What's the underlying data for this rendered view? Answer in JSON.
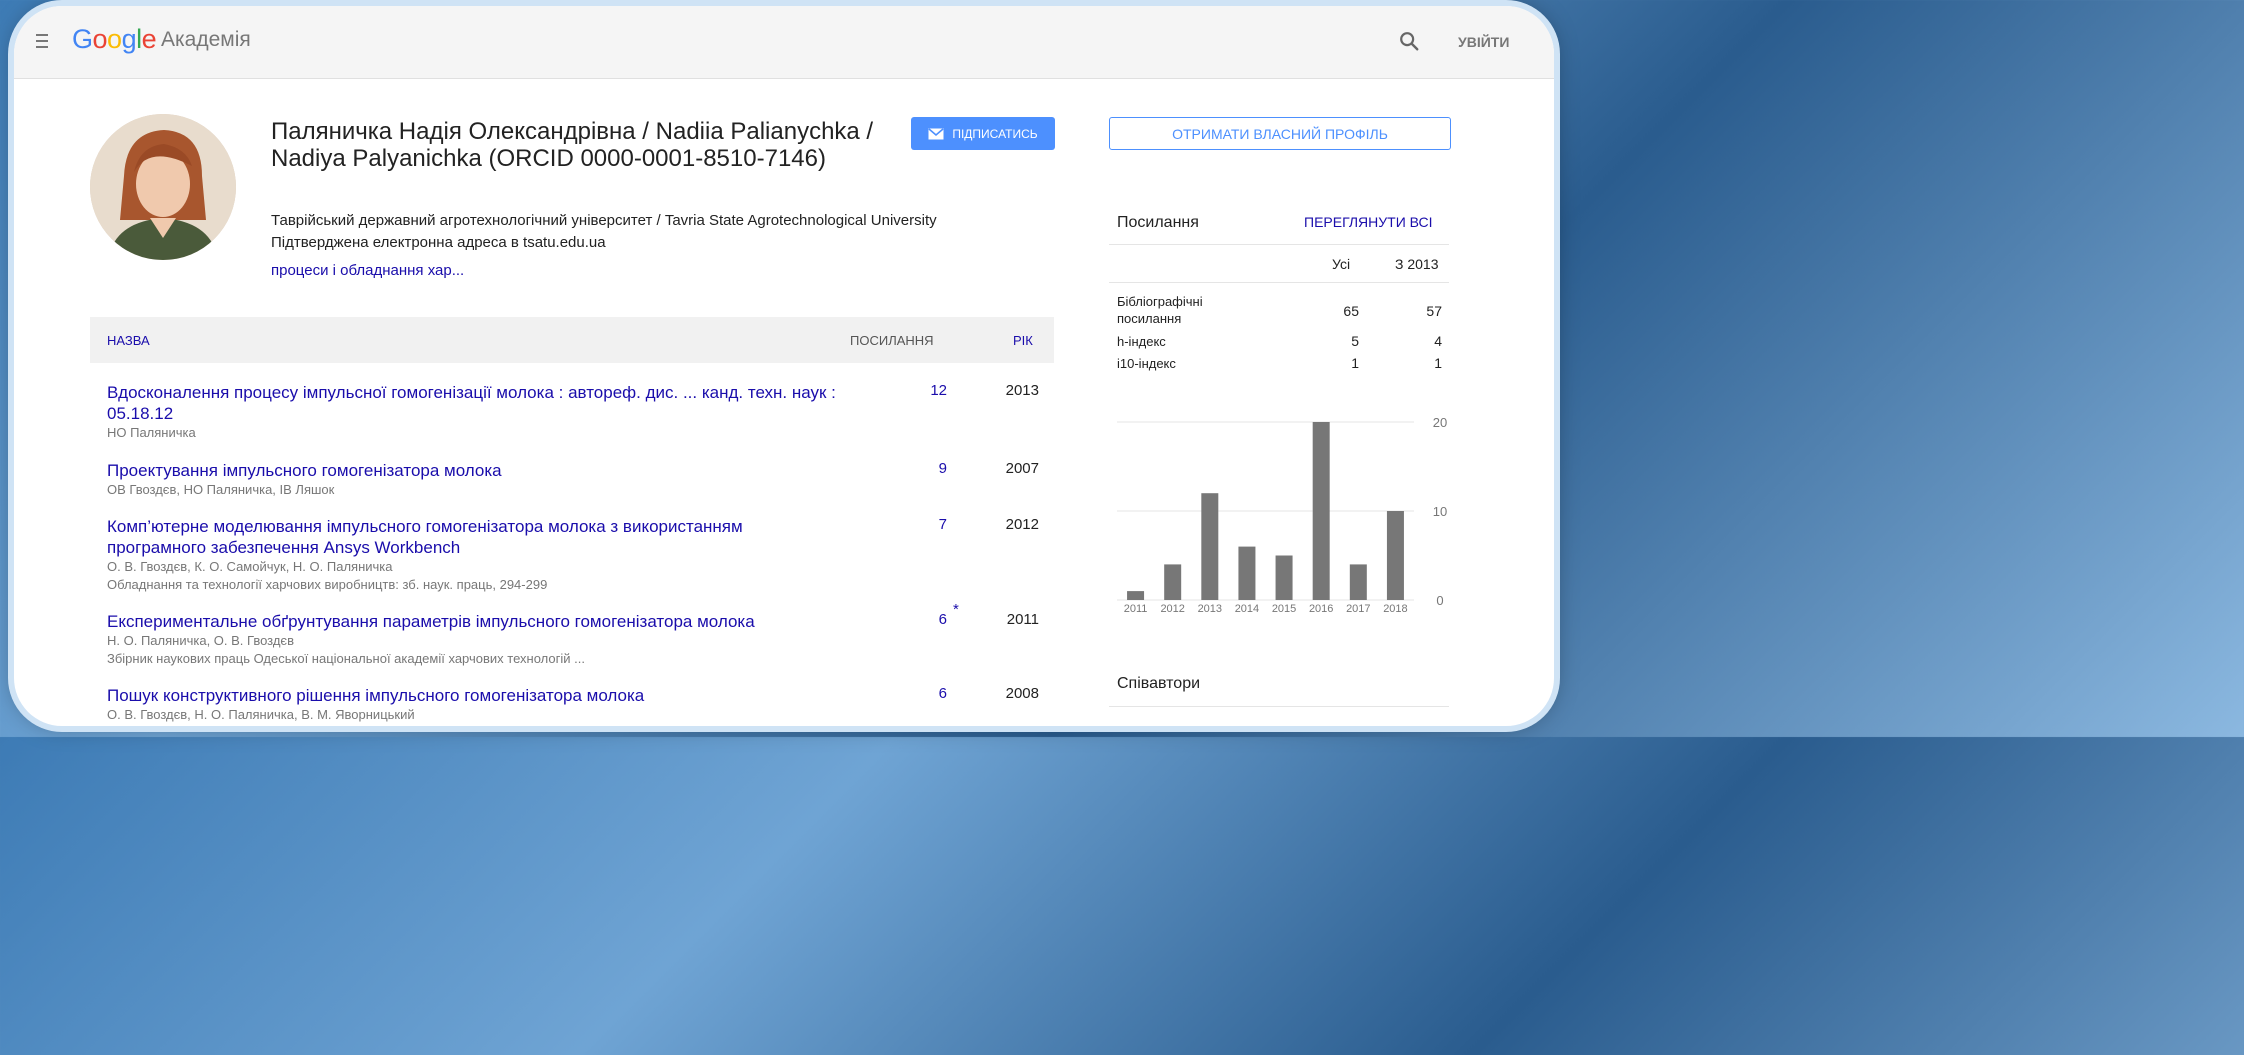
{
  "header": {
    "logo": "Google",
    "product": "Академія",
    "signin_label": "УВІЙТИ"
  },
  "profile": {
    "name": "Паляничка Надія Олександрівна / Nadiia Palianychka / Nadiya Palyanichka (ORCID 0000-0001-8510-7146)",
    "affiliation": "Таврійський державний агротехнологічний університет / Tavria State Agrotechnological University",
    "email": "Підтверджена електронна адреса в tsatu.edu.ua",
    "interest": "процеси і обладнання хар...",
    "follow_label": "ПІДПИСАТИСЬ"
  },
  "table": {
    "col_title": "НАЗВА",
    "col_cited": "ПОСИЛАННЯ",
    "col_year": "РІК",
    "rows": [
      {
        "title": "Вдосконалення процесу імпульсної гомогенізації молока : автореф. дис. ... канд. техн. наук : 05.18.12",
        "authors": "НО Паляничка",
        "source": "",
        "cited": "12",
        "year": "2013"
      },
      {
        "title": "Проектування імпульсного гомогенізатора молока",
        "authors": "ОВ Гвоздєв, НО Паляничка, ІВ Ляшок",
        "source": "",
        "cited": "9",
        "year": "2007"
      },
      {
        "title": "Комп’ютерне моделювання імпульсного гомогенізатора молока з використанням програмного забезпечення Ansys Workbench",
        "authors": "О. В. Гвоздєв, К. О. Самойчук, Н. О. Паляничка",
        "source": "Обладнання та технології харчових виробництв: зб. наук. праць, 294-299",
        "cited": "7",
        "year": "2012"
      },
      {
        "title": "Експериментальне обґрунтування параметрів імпульсного гомогенізатора молока",
        "authors": "Н. О. Паляничка, О. В. Гвоздєв",
        "source": "Збірник наукових праць Одеської національної академії харчових технологій ...",
        "cited": "6",
        "star": "*",
        "year": "2011"
      },
      {
        "title": "Пошук конструктивного рішення імпульсного гомогенізатора молока",
        "authors": "О. В. Гвоздєв, Н. О. Паляничка, В. М. Яворницький",
        "source": "",
        "cited": "6",
        "year": "2008"
      }
    ]
  },
  "sidebar": {
    "get_profile_label": "ОТРИМАТИ ВЛАСНИЙ ПРОФІЛЬ",
    "citations_title": "Посилання",
    "view_all_label": "ПЕРЕГЛЯНУТИ ВСІ",
    "col_all": "Усі",
    "col_since": "З 2013",
    "metrics": [
      {
        "label": "Бібліографічні посилання",
        "all": "65",
        "since": "57"
      },
      {
        "label": "h-індекс",
        "all": "5",
        "since": "4"
      },
      {
        "label": "i10-індекс",
        "all": "1",
        "since": "1"
      }
    ],
    "coauthors_title": "Співавтори"
  },
  "chart_data": {
    "type": "bar",
    "categories": [
      "2011",
      "2012",
      "2013",
      "2014",
      "2015",
      "2016",
      "2017",
      "2018"
    ],
    "values": [
      1,
      4,
      12,
      6,
      5,
      20,
      4,
      10
    ],
    "ylim": [
      0,
      20
    ],
    "yticks": [
      "20",
      "10",
      "0"
    ],
    "bar_color": "#777777",
    "grid": true
  },
  "colors": {
    "link": "#1a0dab",
    "accent": "#4d90fe"
  }
}
